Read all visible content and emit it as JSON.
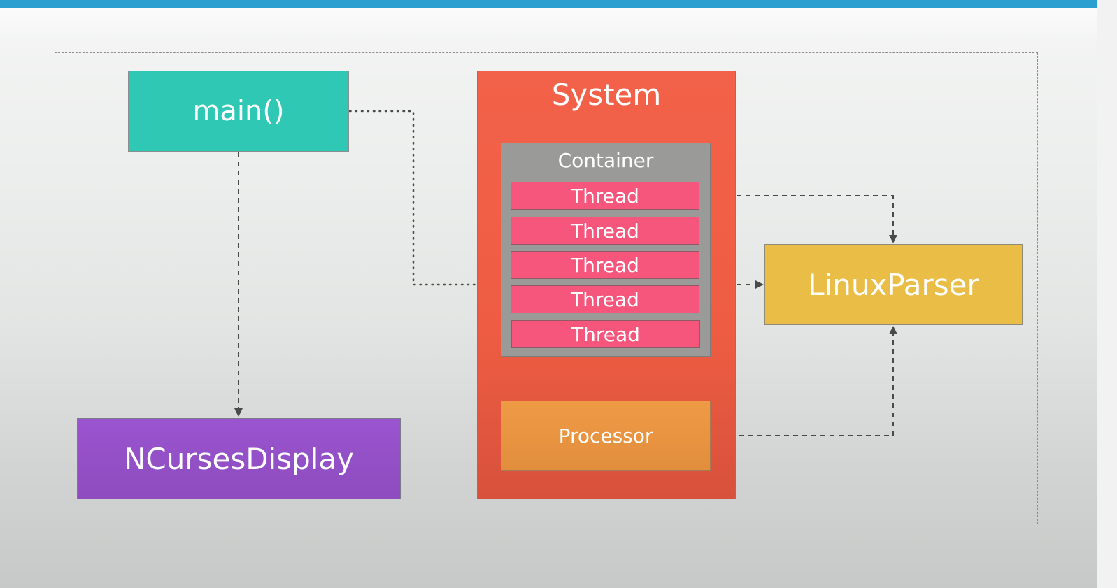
{
  "colors": {
    "top_bar": "#2a9fd0",
    "main": "#2ec8b5",
    "ncurses": "#9a54cf",
    "system": "#f26149",
    "container": "#9a9b99",
    "thread": "#f6567c",
    "processor": "#ef9a45",
    "linux_parser": "#e9bd46",
    "connector": "#4a4a4a"
  },
  "nodes": {
    "main": "main()",
    "ncurses_display": "NCursesDisplay",
    "system": "System",
    "container": "Container",
    "threads": [
      "Thread",
      "Thread",
      "Thread",
      "Thread",
      "Thread"
    ],
    "processor": "Processor",
    "linux_parser": "LinuxParser"
  },
  "edges": [
    {
      "from": "main()",
      "to": "NCursesDisplay",
      "style": "dashed",
      "arrow": true
    },
    {
      "from": "main()",
      "to": "System",
      "style": "dotted",
      "arrow": false
    },
    {
      "from": "System",
      "to": "LinuxParser",
      "style": "dashed",
      "arrow": true
    },
    {
      "from": "Thread",
      "to": "LinuxParser",
      "style": "dashed",
      "arrow": true
    },
    {
      "from": "Processor",
      "to": "LinuxParser",
      "style": "dashed",
      "arrow": true
    }
  ]
}
